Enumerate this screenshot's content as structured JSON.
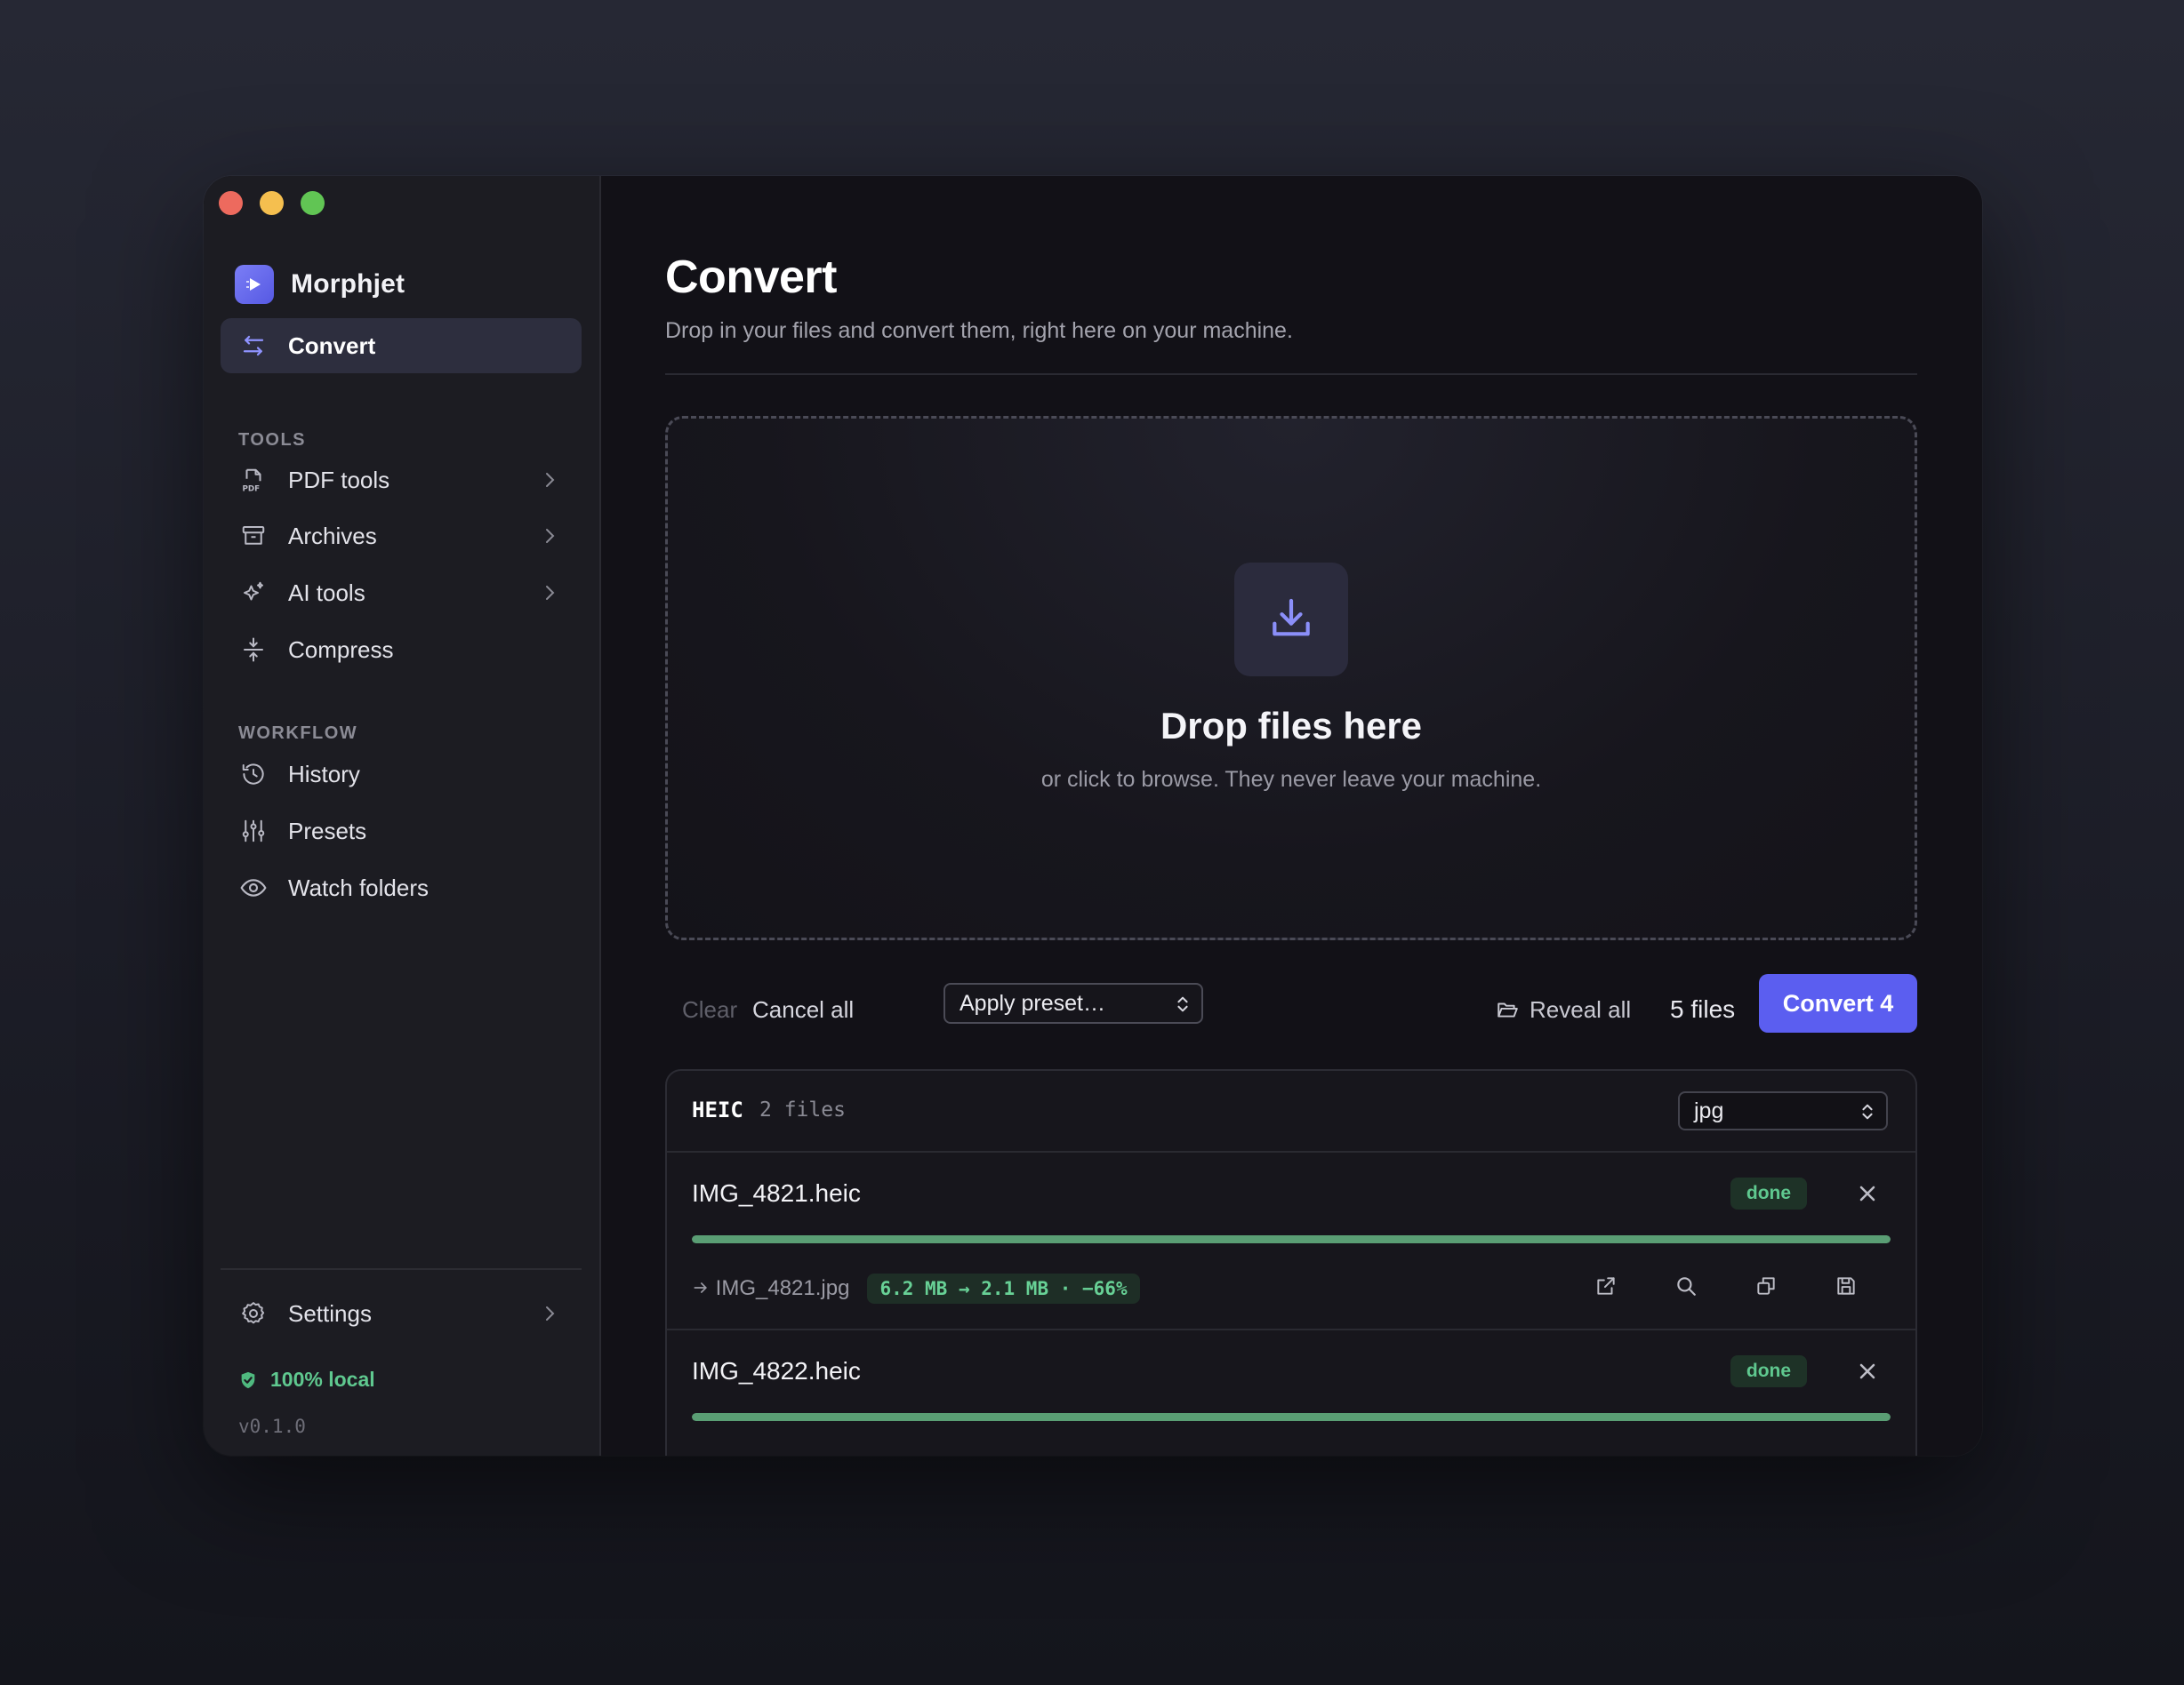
{
  "app": {
    "name": "Morphjet",
    "version": "v0.1.0",
    "local_label": "100% local"
  },
  "sidebar": {
    "active_item": {
      "label": "Convert",
      "icon": "swap-arrows-icon"
    },
    "sections": [
      {
        "label": "TOOLS",
        "items": [
          {
            "label": "PDF tools",
            "icon": "pdf-file-icon",
            "has_submenu": true
          },
          {
            "label": "Archives",
            "icon": "archive-box-icon",
            "has_submenu": true
          },
          {
            "label": "AI tools",
            "icon": "sparkles-icon",
            "has_submenu": true
          },
          {
            "label": "Compress",
            "icon": "compress-icon",
            "has_submenu": false
          }
        ]
      },
      {
        "label": "WORKFLOW",
        "items": [
          {
            "label": "History",
            "icon": "history-icon"
          },
          {
            "label": "Presets",
            "icon": "sliders-icon"
          },
          {
            "label": "Watch folders",
            "icon": "eye-icon"
          }
        ]
      }
    ],
    "settings": {
      "label": "Settings",
      "icon": "gear-icon"
    }
  },
  "main": {
    "title": "Convert",
    "subtitle": "Drop in your files and convert them, right here on your machine.",
    "dropzone": {
      "title": "Drop files here",
      "subtitle": "or click to browse. They never leave your machine.",
      "icon": "download-tray-icon"
    },
    "toolbar": {
      "clear_label": "Clear",
      "cancel_label": "Cancel all",
      "preset_placeholder": "Apply preset…",
      "reveal_label": "Reveal all",
      "files_count": "5 files",
      "convert_label": "Convert 4"
    },
    "groups": [
      {
        "format": "HEIC",
        "count_label": "2 files",
        "target_format": "jpg",
        "files": [
          {
            "name": "IMG_4821.heic",
            "status": "done",
            "progress": 1.0,
            "output_name": "IMG_4821.jpg",
            "size_summary": "6.2 MB → 2.1 MB · −66%"
          },
          {
            "name": "IMG_4822.heic",
            "status": "done",
            "progress": 1.0
          }
        ]
      }
    ]
  },
  "colors": {
    "accent": "#5b5ef0",
    "success": "#5fc88f",
    "progress": "#5a9e74",
    "sidebar_bg": "#1c1c22",
    "main_bg": "#121117"
  }
}
